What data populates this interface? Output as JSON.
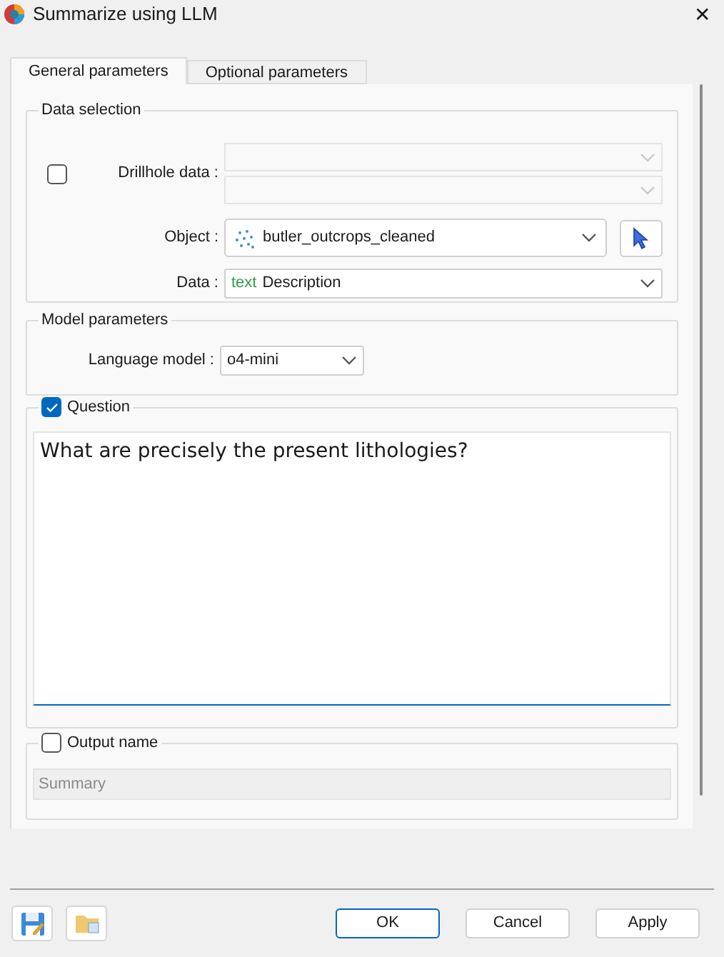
{
  "window": {
    "title": "Summarize using LLM",
    "close": "✕"
  },
  "tabs": [
    {
      "label": "General parameters",
      "selected": true
    },
    {
      "label": "Optional parameters",
      "selected": false
    }
  ],
  "data_selection": {
    "title": "Data selection",
    "drillhole": {
      "label": "Drillhole data :",
      "checked": false
    },
    "object": {
      "label": "Object :",
      "value": "butler_outcrops_cleaned"
    },
    "data": {
      "label": "Data :",
      "tag": "text",
      "value": "Description"
    }
  },
  "model_parameters": {
    "title": "Model parameters",
    "language_model": {
      "label": "Language model :",
      "value": "o4-mini"
    }
  },
  "question": {
    "label": "Question",
    "checked": true,
    "value": "What are precisely the present lithologies? "
  },
  "output_name": {
    "label": "Output name",
    "checked": false,
    "value": "Summary",
    "disabled": true
  },
  "buttons": [
    "OK",
    "Cancel",
    "Apply"
  ]
}
